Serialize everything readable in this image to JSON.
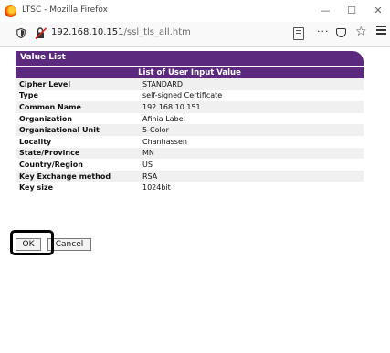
{
  "window": {
    "title": "LTSC - Mozilla Firefox",
    "minimize": "—",
    "maximize": "☐",
    "close": "✕"
  },
  "address_bar": {
    "host": "192.168.10.151",
    "path": "/ssl_tls_all.htm",
    "menu_dots": "···",
    "star": "☆"
  },
  "panel": {
    "title": "Value List",
    "table_header": "List of User Input Value",
    "rows": [
      {
        "label": "Cipher Level",
        "value": "STANDARD"
      },
      {
        "label": "Type",
        "value": "self-signed Certificate"
      },
      {
        "label": "Common Name",
        "value": "192.168.10.151"
      },
      {
        "label": "Organization",
        "value": "Afinia Label"
      },
      {
        "label": "Organizational Unit",
        "value": "5-Color"
      },
      {
        "label": "Locality",
        "value": "Chanhassen"
      },
      {
        "label": "State/Province",
        "value": "MN"
      },
      {
        "label": "Country/Region",
        "value": "US"
      },
      {
        "label": "Key Exchange method",
        "value": "RSA"
      },
      {
        "label": "Key size",
        "value": "1024bit"
      }
    ]
  },
  "buttons": {
    "ok": "OK",
    "cancel": "Cancel"
  },
  "colors": {
    "accent": "#5b2a7e",
    "row_shade": "#f0f0f0"
  }
}
